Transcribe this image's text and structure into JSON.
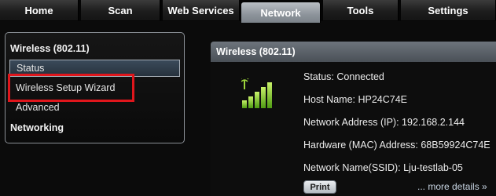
{
  "tabs": [
    {
      "label": "Home"
    },
    {
      "label": "Scan"
    },
    {
      "label": "Web Services"
    },
    {
      "label": "Network",
      "active": true
    },
    {
      "label": "Tools"
    },
    {
      "label": "Settings"
    }
  ],
  "sidebar": {
    "heading": "Wireless (802.11)",
    "items": [
      {
        "label": "Status",
        "selected": true
      },
      {
        "label": "Wireless Setup Wizard",
        "highlighted": true
      },
      {
        "label": "Advanced"
      }
    ],
    "section2": "Networking"
  },
  "panel": {
    "title": "Wireless (802.11)",
    "icon": "wifi-signal-icon",
    "status": "Status: Connected",
    "host_name": "Host Name: HP24C74E",
    "ip": "Network Address (IP): 192.168.2.144",
    "mac": "Hardware (MAC) Address: 68B59924C74E",
    "ssid": "Network Name(SSID): Lju-testlab-05",
    "print_label": "Print",
    "more_label": "... more details",
    "more_arrow": "»"
  },
  "colors": {
    "highlight": "#e0161c",
    "active_tab": "#8d949b",
    "signal_green": "#8fd62a"
  }
}
